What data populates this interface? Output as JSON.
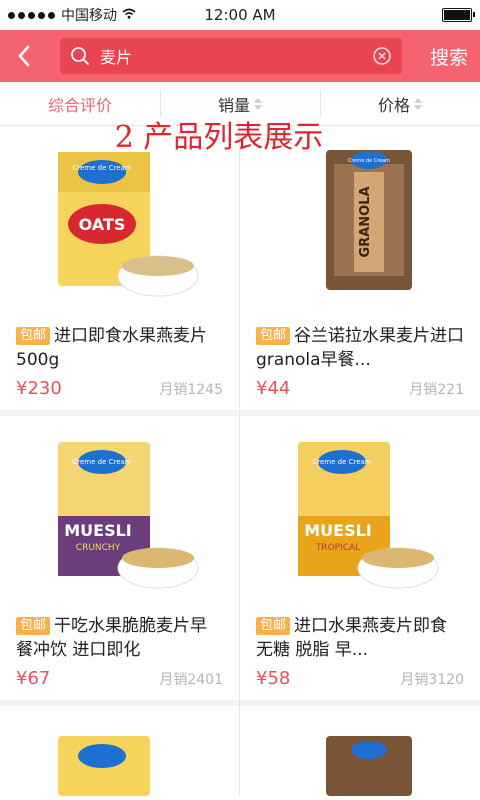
{
  "status": {
    "carrier": "中国移动",
    "time": "12:00 AM",
    "battery_level": 1.0
  },
  "header": {
    "search_value": "麦片",
    "search_button": "搜索"
  },
  "tabs": [
    {
      "label": "综合评价",
      "active": true
    },
    {
      "label": "销量",
      "sortable": true
    },
    {
      "label": "价格",
      "sortable": true
    }
  ],
  "overlay_caption": "2 产品列表展示",
  "products": [
    {
      "badge": "包邮",
      "title": "进口即食水果燕麦片500g",
      "price": "¥230",
      "sales": "月销1245",
      "brand": "Creme de Cream",
      "label": "OATS"
    },
    {
      "badge": "包邮",
      "title": "谷兰诺拉水果麦片进口granola早餐...",
      "price": "¥44",
      "sales": "月销221",
      "brand": "Creme de Cream",
      "label": "GRANOLA"
    },
    {
      "badge": "包邮",
      "title": "干吃水果脆脆麦片早餐冲饮 进口即化",
      "price": "¥67",
      "sales": "月销2401",
      "brand": "Creme de Cream",
      "label": "MUESLI",
      "sublabel": "CRUNCHY"
    },
    {
      "badge": "包邮",
      "title": "进口水果燕麦片即食 无糖 脱脂 早...",
      "price": "¥58",
      "sales": "月销3120",
      "brand": "Creme de Cream",
      "label": "MUESLI",
      "sublabel": "TROPICAL"
    }
  ],
  "colors": {
    "header": "#f5646e",
    "accent": "#f06570",
    "badge": "#f7b24d",
    "price": "#f0505a",
    "overlay": "#e3232f"
  },
  "icons": {
    "back": "chevron-left-icon",
    "search": "search-icon",
    "clear": "clear-circle-icon"
  }
}
